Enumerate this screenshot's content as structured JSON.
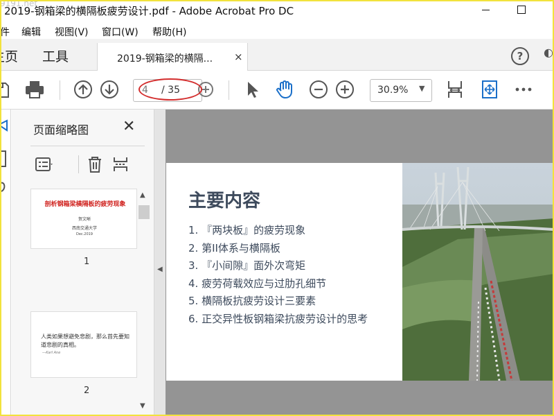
{
  "window": {
    "title": "2019-钢箱梁的横隔板疲劳设计.pdf - Adobe Acrobat Pro DC",
    "watermark": "9191.net"
  },
  "menu": [
    {
      "label": "件"
    },
    {
      "label": "编辑"
    },
    {
      "label": "视图(V)"
    },
    {
      "label": "窗口(W)"
    },
    {
      "label": "帮助(H)"
    }
  ],
  "tabs": {
    "home": "主页",
    "tools": "工具",
    "document": "2019-钢箱梁的横隔...",
    "close": "×"
  },
  "toolbar": {
    "page_current": "4",
    "page_total": "/ 35",
    "zoom": "30.9%",
    "zoom_caret": "▼"
  },
  "thumbnails": {
    "title": "页面缩略图",
    "close": "✕",
    "items": [
      {
        "number": "1",
        "title": "剖析钢箱梁横隔板的疲劳现象",
        "author": "贺文晰",
        "institution": "西南交通大学",
        "date": "Dec.2019"
      },
      {
        "number": "2",
        "line1": "人类如果想避免悲剧，那么首先要知",
        "line2": "道悲剧的真相。",
        "signature": "---Karl Ane"
      }
    ],
    "scroll_up": "▲",
    "scroll_down": "▼"
  },
  "splitter_arrow": "◀",
  "slide": {
    "heading": "主要内容",
    "items": [
      "1. 『两块板』的疲劳现象",
      "2. 第II体系与横隔板",
      "3. 『小间隙』面外次弯矩",
      "4. 疲劳荷载效应与过肋孔细节",
      "5. 横隔板抗疲劳设计三要素",
      "6. 正交异性板钢箱梁抗疲劳设计的思考"
    ]
  },
  "help_icon": "?",
  "colors": {
    "annotation_circle": "#d32d2d",
    "thumbnail_title": "#d0231f",
    "slide_text": "#3d4a5c",
    "document_background": "#949494"
  }
}
